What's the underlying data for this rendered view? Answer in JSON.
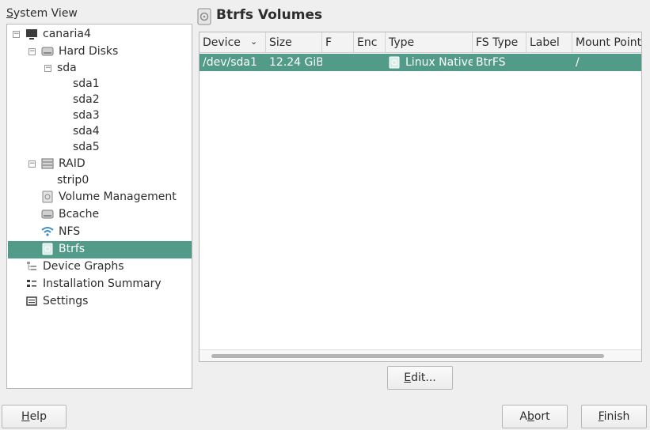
{
  "system_view": {
    "prefix": "S",
    "rest": "ystem View"
  },
  "tree": {
    "host": "canaria4",
    "hard_disks": "Hard Disks",
    "sda": "sda",
    "partitions": [
      "sda1",
      "sda2",
      "sda3",
      "sda4",
      "sda5"
    ],
    "raid": "RAID",
    "strip0": "strip0",
    "volume_management": "Volume Management",
    "bcache": "Bcache",
    "nfs": "NFS",
    "btrfs": "Btrfs",
    "device_graphs": "Device Graphs",
    "installation_summary": "Installation Summary",
    "settings": "Settings"
  },
  "panel": {
    "title": "Btrfs Volumes",
    "columns": [
      "Device",
      "Size",
      "F",
      "Enc",
      "Type",
      "FS Type",
      "Label",
      "Mount Point"
    ],
    "rows": [
      {
        "device": "/dev/sda1",
        "size": "12.24 GiB",
        "f": "",
        "enc": "",
        "type": "Linux Native",
        "fs_type": "BtrFS",
        "label": "",
        "mount": "/"
      }
    ]
  },
  "buttons": {
    "edit": {
      "prefix": "E",
      "rest": "dit..."
    },
    "help": {
      "prefix": "H",
      "rest": "elp"
    },
    "abort": {
      "prefix": "A",
      "mid": "b",
      "rest": "ort"
    },
    "finish": {
      "prefix": "F",
      "rest": "inish"
    }
  },
  "colors": {
    "selection": "#529b88",
    "background": "#efefef"
  }
}
